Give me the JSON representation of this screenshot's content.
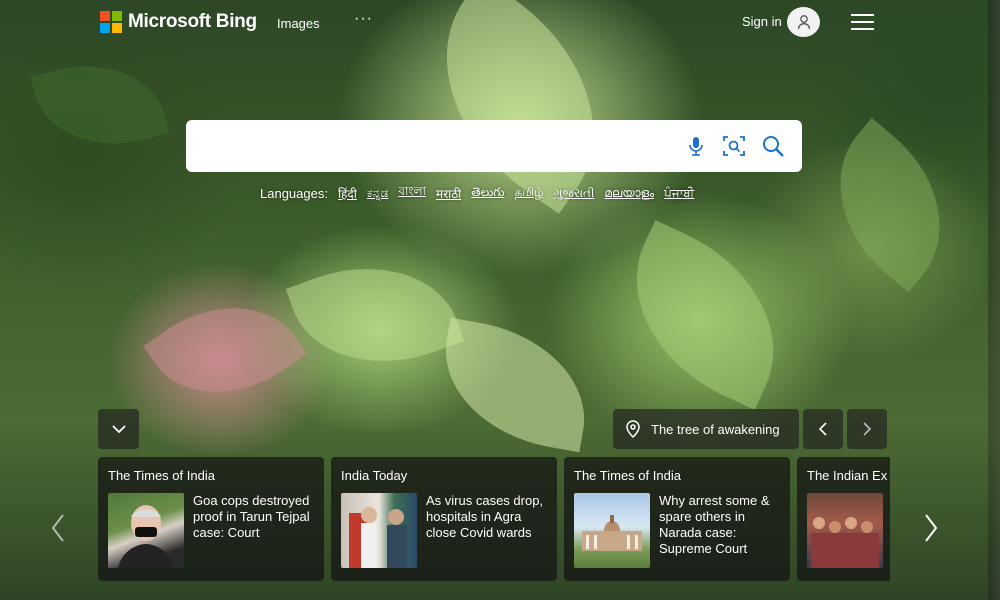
{
  "header": {
    "logo_text": "Microsoft Bing",
    "nav": {
      "images": "Images",
      "more": "···"
    },
    "signin": "Sign in",
    "colors": {
      "ms_red": "#f25022",
      "ms_green": "#7fba00",
      "ms_blue": "#00a4ef",
      "ms_yellow": "#ffb900"
    },
    "icons": {
      "avatar": "user-icon",
      "menu": "hamburger-menu-icon"
    }
  },
  "search": {
    "value": "",
    "placeholder": "",
    "icons": [
      "microphone-icon",
      "visual-search-icon",
      "search-icon"
    ]
  },
  "languages": {
    "title": "Languages:",
    "items": [
      "हिंदी",
      "ಕನ್ನಡ",
      "বাংলা",
      "मराठी",
      "తెలుగు",
      "தமிழ்",
      "ગુજરાતી",
      "മലയാളം",
      "ਪੰਜਾਬੀ"
    ]
  },
  "image_info": {
    "title": "The tree of awakening",
    "icons": {
      "collapse": "chevron-down-icon",
      "pin": "location-pin-icon",
      "prev": "chevron-left-icon",
      "next": "chevron-right-icon"
    }
  },
  "news": [
    {
      "source": "The Times of India",
      "headline": "Goa cops destroyed proof in Tarun Tejpal case: Court"
    },
    {
      "source": "India Today",
      "headline": "As virus cases drop, hospitals in Agra close Covid wards"
    },
    {
      "source": "The Times of India",
      "headline": "Why arrest some & spare others in Narada case: Supreme Court"
    },
    {
      "source": "The Indian Ex",
      "headline": ""
    }
  ]
}
